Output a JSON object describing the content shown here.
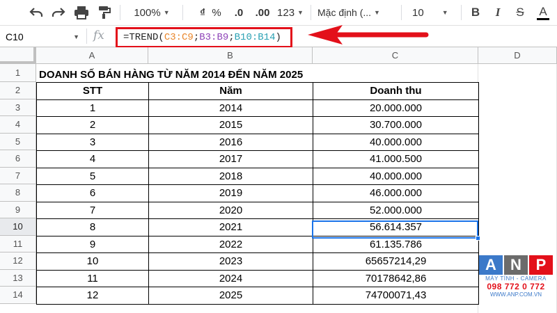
{
  "toolbar": {
    "icons": [
      "undo-icon",
      "redo-icon",
      "print-icon",
      "paint-format-icon"
    ],
    "zoom": "100%",
    "currency": "₫",
    "percent": "%",
    "decrease_decimal": ".0",
    "increase_decimal": ".00",
    "more_formats": "123",
    "font": "Mặc định (...",
    "font_size": "10",
    "bold": "B",
    "italic": "I",
    "strikethrough": "S",
    "text_color": "A"
  },
  "formula_bar": {
    "cell_ref": "C10",
    "fx": "fx",
    "formula_parts": {
      "prefix": "=TREND(",
      "arg1": "C3:C9",
      "sep1": ";",
      "arg2": "B3:B9",
      "sep2": ";",
      "arg3": "B10:B14",
      "suffix": ")"
    }
  },
  "columns": [
    "A",
    "B",
    "C",
    "D"
  ],
  "rows": [
    "1",
    "2",
    "3",
    "4",
    "5",
    "6",
    "7",
    "8",
    "9",
    "10",
    "11",
    "12",
    "13",
    "14"
  ],
  "active_row": "10",
  "sheet": {
    "title": "DOANH SỐ BÁN HÀNG TỪ NĂM 2014 ĐẾN NĂM 2025",
    "headers": [
      "STT",
      "Năm",
      "Doanh thu"
    ],
    "data": [
      [
        "1",
        "2014",
        "20.000.000"
      ],
      [
        "2",
        "2015",
        "30.700.000"
      ],
      [
        "3",
        "2016",
        "40.000.000"
      ],
      [
        "4",
        "2017",
        "41.000.500"
      ],
      [
        "5",
        "2018",
        "40.000.000"
      ],
      [
        "6",
        "2019",
        "46.000.000"
      ],
      [
        "7",
        "2020",
        "52.000.000"
      ],
      [
        "8",
        "2021",
        "56.614.357"
      ],
      [
        "9",
        "2022",
        "61.135.786"
      ],
      [
        "10",
        "2023",
        "65657214,29"
      ],
      [
        "11",
        "2024",
        "70178642,86"
      ],
      [
        "12",
        "2025",
        "74700071,43"
      ]
    ]
  },
  "watermark": {
    "letters": [
      "A",
      "N",
      "P"
    ],
    "tagline": "MÁY TÍNH - CAMERA",
    "phone": "098 772 0 772",
    "website": "WWW.ANP.COM.VN"
  },
  "colors": {
    "highlight_red": "#e3101a",
    "selection_blue": "#1a73e8",
    "ref_orange": "#e9862b",
    "ref_purple": "#8e43b8",
    "ref_teal": "#2aa1b3"
  }
}
